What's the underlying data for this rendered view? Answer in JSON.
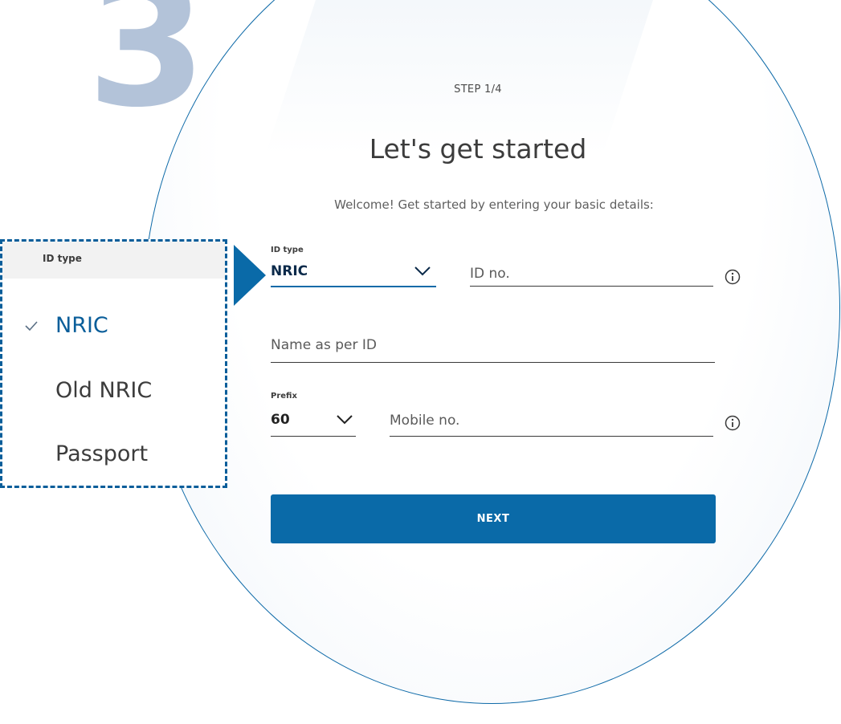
{
  "step_number": "3",
  "form": {
    "step_label": "STEP 1/4",
    "title": "Let's get started",
    "subtitle": "Welcome! Get started by entering your basic details:",
    "id_type": {
      "label": "ID type",
      "value": "NRIC"
    },
    "id_no": {
      "placeholder": "ID no."
    },
    "name": {
      "placeholder": "Name as per ID"
    },
    "prefix": {
      "label": "Prefix",
      "value": "60"
    },
    "mobile": {
      "placeholder": "Mobile no."
    },
    "next_label": "NEXT"
  },
  "dropdown": {
    "header": "ID type",
    "options": [
      {
        "label": "NRIC",
        "selected": true
      },
      {
        "label": "Old NRIC",
        "selected": false
      },
      {
        "label": "Passport",
        "selected": false
      }
    ]
  },
  "icons": {
    "chevron": "chevron-down-icon",
    "info": "info-icon",
    "check": "check-icon",
    "pointer": "pointer-arrow-icon"
  },
  "colors": {
    "brand_blue": "#0a6aa8",
    "step_number": "#b3c3d9",
    "callout_border": "#0a5e9a",
    "text_dark": "#3c3c3c"
  }
}
